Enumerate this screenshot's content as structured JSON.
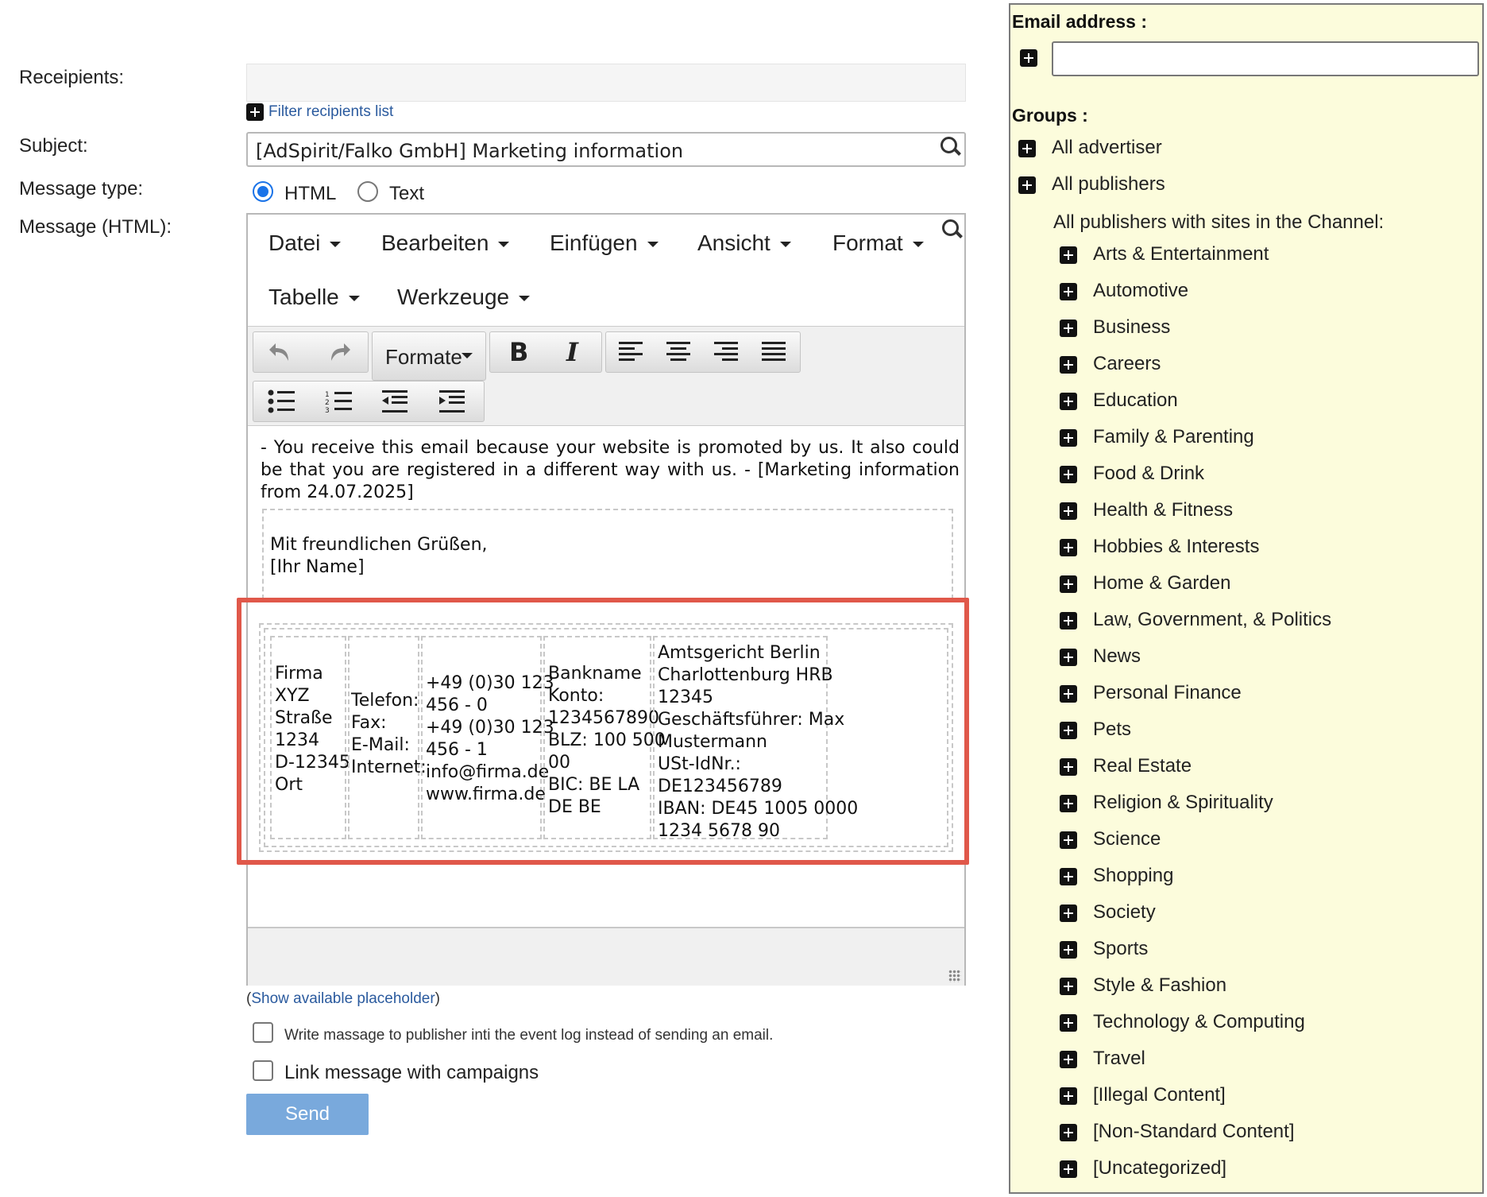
{
  "form": {
    "recipients_label": "Receipients:",
    "filter_link": "Filter recipients list",
    "subject_label": "Subject:",
    "subject_value": "[AdSpirit/Falko GmbH]  Marketing information",
    "message_type_label": "Message type:",
    "type_html": "HTML",
    "type_text": "Text",
    "message_label": "Message (HTML):"
  },
  "editor": {
    "menu": [
      "Datei",
      "Bearbeiten",
      "Einfügen",
      "Ansicht",
      "Format",
      "Tabelle",
      "Werkzeuge"
    ],
    "formats_label": "Formate",
    "intro_text": "- You receive this email because your website is promoted by us. It also could be that you are registered in a different way with us. - [Marketing information from 24.07.2025]",
    "signature": [
      "Mit freundlichen Grüßen,",
      "[Ihr Name]"
    ],
    "footer": {
      "col1": "Firma\nXYZ\nStraße\n1234\nD-12345\nOrt",
      "col2": "Telefon:\nFax:\nE-Mail:\nInternet:",
      "col3": "+49 (0)30 123\n456 - 0\n+49 (0)30 123\n456 - 1\ninfo@firma.de\nwww.firma.de",
      "col4": "Bankname\nKonto:\n1234567890\nBLZ: 100 500\n00\nBIC: BE LA\nDE BE",
      "col5": "Amtsgericht Berlin\nCharlottenburg HRB\n12345\nGeschäftsführer: Max\nMustermann\nUSt-IdNr.:\nDE123456789\nIBAN: DE45 1005 0000\n1234 5678 90"
    }
  },
  "below": {
    "paren_open": "(",
    "placeholder_link": "Show available placeholder",
    "paren_close": ")",
    "event_log_label": "Write massage to publisher inti the event log instead of sending an email.",
    "link_campaigns_label": "Link message with campaigns",
    "send_label": "Send"
  },
  "right_panel": {
    "email_label": "Email address :",
    "email_value": "",
    "groups_label": "Groups :",
    "top_groups": [
      "All advertiser",
      "All publishers"
    ],
    "channel_label": "All publishers with sites in the Channel:",
    "channels": [
      "Arts & Entertainment",
      "Automotive",
      "Business",
      "Careers",
      "Education",
      "Family & Parenting",
      "Food & Drink",
      "Health & Fitness",
      "Hobbies & Interests",
      "Home & Garden",
      "Law, Government, & Politics",
      "News",
      "Personal Finance",
      "Pets",
      "Real Estate",
      "Religion & Spirituality",
      "Science",
      "Shopping",
      "Society",
      "Sports",
      "Style & Fashion",
      "Technology & Computing",
      "Travel",
      "[Illegal Content]",
      "[Non-Standard Content]",
      "[Uncategorized]"
    ]
  },
  "colors": {
    "highlight": "#e0584a",
    "panel_bg": "#fcfcdc",
    "link": "#2a5a9e",
    "send_btn": "#79a9dc",
    "radio_active": "#1a73e8"
  }
}
